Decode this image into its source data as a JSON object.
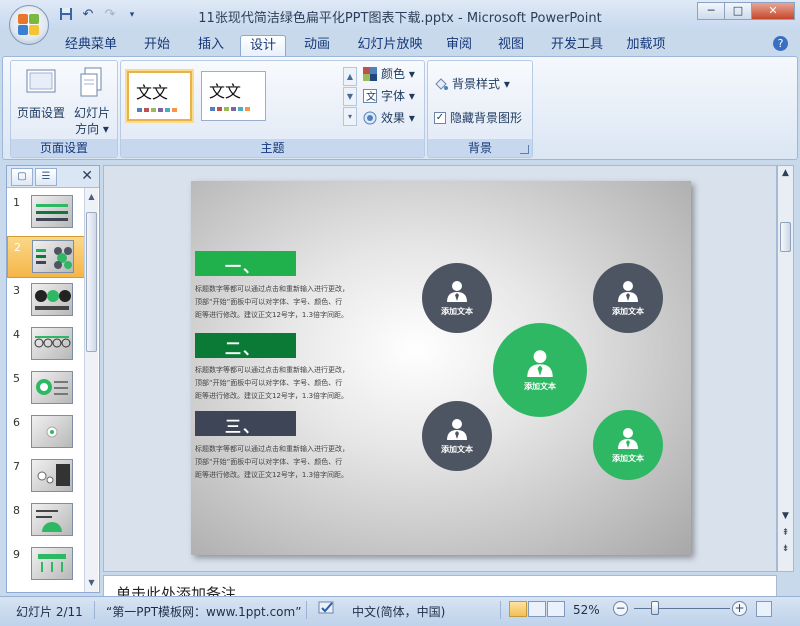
{
  "window": {
    "title": "11张现代简洁绿色扁平化PPT图表下载.pptx - Microsoft PowerPoint",
    "minimize": "─",
    "maximize": "□",
    "close": "✕"
  },
  "quick_access": [
    "save-icon",
    "undo-icon",
    "redo-icon",
    "customize-icon"
  ],
  "tabs": [
    {
      "label": "经典菜单",
      "active": false
    },
    {
      "label": "开始",
      "active": false
    },
    {
      "label": "插入",
      "active": false
    },
    {
      "label": "设计",
      "active": true
    },
    {
      "label": "动画",
      "active": false
    },
    {
      "label": "幻灯片放映",
      "active": false
    },
    {
      "label": "审阅",
      "active": false
    },
    {
      "label": "视图",
      "active": false
    },
    {
      "label": "开发工具",
      "active": false
    },
    {
      "label": "加载项",
      "active": false
    }
  ],
  "ribbon": {
    "page_setup": {
      "label": "页面设置",
      "page_setup_btn": "页面设置",
      "orientation_btn_1": "幻灯片",
      "orientation_btn_2": "方向 ▾"
    },
    "themes": {
      "label": "主题",
      "theme_1": "文文",
      "theme_2": "文文",
      "colors": "颜色 ▾",
      "fonts": "字体 ▾",
      "effects": "效果 ▾"
    },
    "background": {
      "label": "背景",
      "styles": "背景样式 ▾",
      "hide_graphics": "隐藏背景图形",
      "hide_graphics_checked": true
    }
  },
  "thumbnails": [
    "1",
    "2",
    "3",
    "4",
    "5",
    "6",
    "7",
    "8",
    "9"
  ],
  "selected_slide": "2",
  "slide": {
    "headings": [
      "一、",
      "二、",
      "三、"
    ],
    "paragraph_lines": [
      "标题数字等都可以通过点击和重新输入进行更改，",
      "顶部“开始”面板中可以对字体、字号、颜色、行",
      "距等进行修改。建议正文12号字，1.3倍字间距。"
    ],
    "circle_label": "添加文本",
    "colors": {
      "green": "#21b14c",
      "dark_green": "#0a7a36",
      "navy": "#3d4556",
      "gray_circle": "#4d5563",
      "accent_green": "#2fb863"
    }
  },
  "notes": "单击此处添加备注",
  "status": {
    "slide_info": "幻灯片 2/11",
    "theme_name": "“第一PPT模板网：www.1ppt.com”",
    "language": "中文(简体，中国)",
    "zoom": "52%"
  }
}
